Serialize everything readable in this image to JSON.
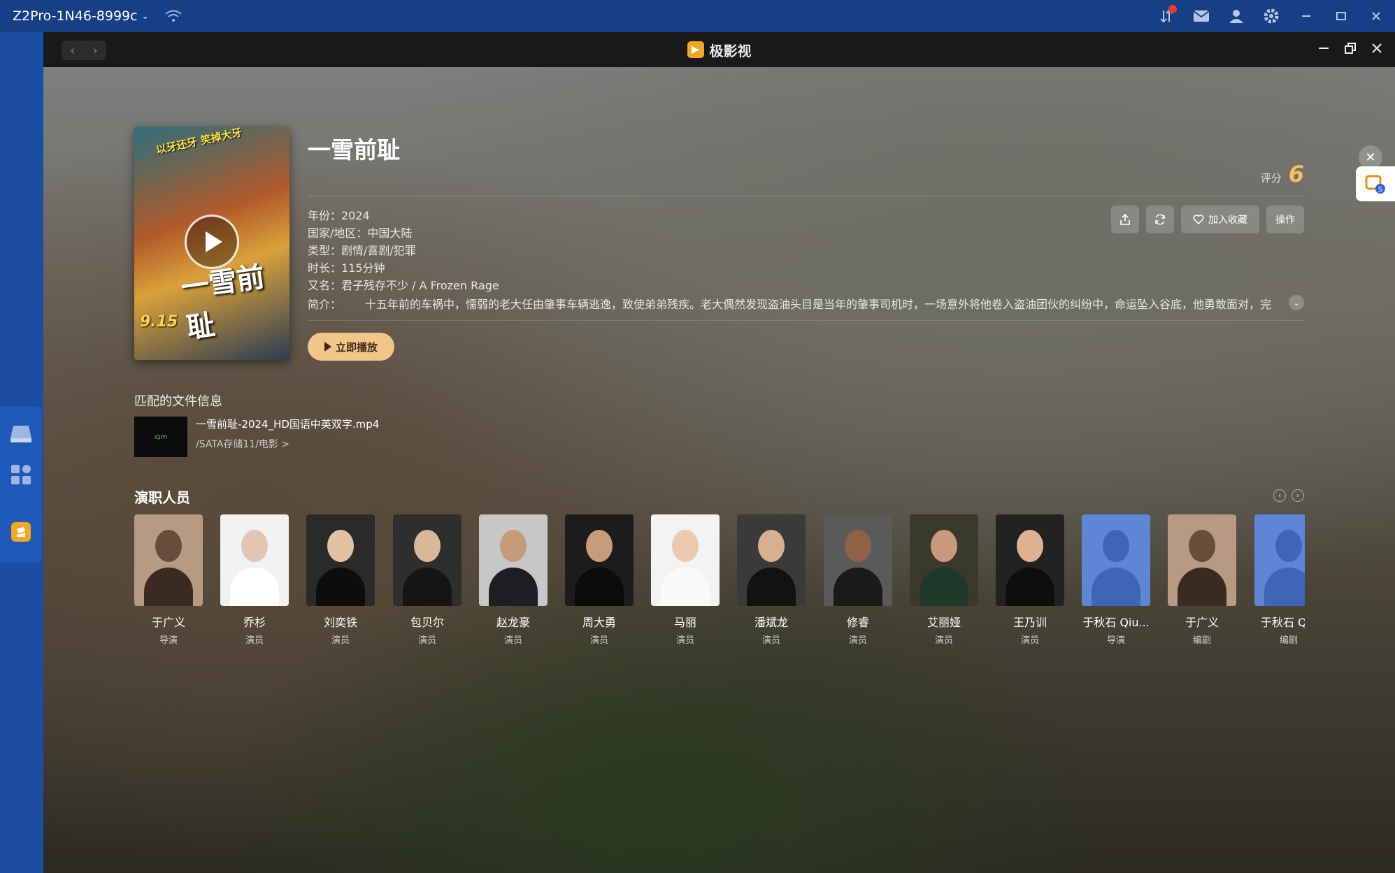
{
  "system_bar": {
    "device_name": "Z2Pro-1N46-8999c",
    "icons": [
      "wifi-icon",
      "transfer-icon",
      "mail-icon",
      "user-icon",
      "gear-icon",
      "minimize-icon",
      "maximize-icon",
      "close-icon"
    ]
  },
  "dock": {
    "icons": [
      "drive-icon",
      "apps-grid-icon",
      "video-app-icon"
    ]
  },
  "window": {
    "title": "极影视",
    "nav_back": "‹",
    "nav_forward": "›"
  },
  "movie": {
    "title": "一雪前耻",
    "rating_label": "评分",
    "rating_value": "6",
    "year": "年份：2024",
    "region": "国家/地区：中国大陆",
    "genre": "类型：剧情/喜剧/犯罪",
    "duration": "时长：115分钟",
    "alias": "又名：君子残存不少 / A Frozen Rage",
    "synopsis_label": "简介：",
    "synopsis": "十五年前的车祸中，懦弱的老大任由肇事车辆逃逸，致使弟弟残疾。老大偶然发现盗油头目是当年的肇事司机时，一场意外将他卷入盗油团伙的纠纷中，命运坠入谷底，他勇敢面对，完",
    "poster_text": "一雪前耻",
    "poster_date": "9.15",
    "poster_tagline": "以牙还牙 笑掉大牙"
  },
  "actions": {
    "share": "",
    "refresh": "",
    "favorite": "加入收藏",
    "operate": "操作"
  },
  "play_now": "立即播放",
  "file_info": {
    "header": "匹配的文件信息",
    "filename": "一雪前耻-2024_HD国语中英双字.mp4",
    "path": "/SATA存储11/电影 >",
    "thumb_text": "iQIYI"
  },
  "cast": {
    "header": "演职人员",
    "members": [
      {
        "name": "于广义",
        "role": "导演"
      },
      {
        "name": "乔杉",
        "role": "演员"
      },
      {
        "name": "刘奕铁",
        "role": "演员"
      },
      {
        "name": "包贝尔",
        "role": "演员"
      },
      {
        "name": "赵龙豪",
        "role": "演员"
      },
      {
        "name": "周大勇",
        "role": "演员"
      },
      {
        "name": "马丽",
        "role": "演员"
      },
      {
        "name": "潘斌龙",
        "role": "演员"
      },
      {
        "name": "修睿",
        "role": "演员"
      },
      {
        "name": "艾丽娅",
        "role": "演员"
      },
      {
        "name": "王乃训",
        "role": "演员"
      },
      {
        "name": "于秋石 Qiu...",
        "role": "导演"
      },
      {
        "name": "于广义",
        "role": "编剧"
      },
      {
        "name": "于秋石 Qiu",
        "role": "编剧"
      }
    ]
  },
  "colors": {
    "system_bar": "#173f86",
    "accent_rating": "#f4c06a",
    "play_button": "#f2c58a"
  }
}
